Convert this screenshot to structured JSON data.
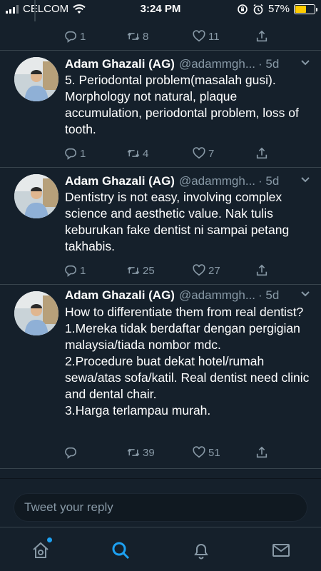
{
  "status_bar": {
    "carrier": "CELCOM",
    "time": "3:24 PM",
    "battery": "57%",
    "battery_level": 0.57
  },
  "top_actions": {
    "reply_count": "1",
    "retweet_count": "8",
    "like_count": "11"
  },
  "tweets": [
    {
      "author": "Adam Ghazali (AG)",
      "handle": "@adammgh...",
      "time": "· 5d",
      "text": "5. Periodontal problem(masalah gusi). Morphology not natural, plaque accumulation, periodontal problem, loss of tooth.",
      "reply_count": "1",
      "retweet_count": "4",
      "like_count": "7"
    },
    {
      "author": "Adam Ghazali (AG)",
      "handle": "@adammgh...",
      "time": "· 5d",
      "text": "Dentistry is not easy, involving complex science and aesthetic value. Nak tulis keburukan fake dentist ni sampai petang takhabis.",
      "reply_count": "1",
      "retweet_count": "25",
      "like_count": "27"
    },
    {
      "author": "Adam Ghazali (AG)",
      "handle": "@adammgh...",
      "time": "· 5d",
      "text": "How to differentiate them from real dentist?\n1.Mereka tidak berdaftar dengan pergigian malaysia/tiada nombor mdc.\n2.Procedure buat dekat hotel/rumah sewa/atas sofa/katil. Real dentist need clinic and dental chair.\n3.Harga terlampau murah.",
      "reply_count": "",
      "retweet_count": "39",
      "like_count": "51"
    }
  ],
  "reply_bar": {
    "placeholder": "Tweet your reply"
  },
  "tabs": [
    {
      "name": "home",
      "icon": "home-icon"
    },
    {
      "name": "search",
      "icon": "search-icon"
    },
    {
      "name": "notifications",
      "icon": "bell-icon"
    },
    {
      "name": "messages",
      "icon": "mail-icon"
    }
  ],
  "colors": {
    "background": "#15202b",
    "accent": "#1da1f2",
    "muted": "#8899a6",
    "divider": "#38444d",
    "battery": "#ffcc00"
  }
}
